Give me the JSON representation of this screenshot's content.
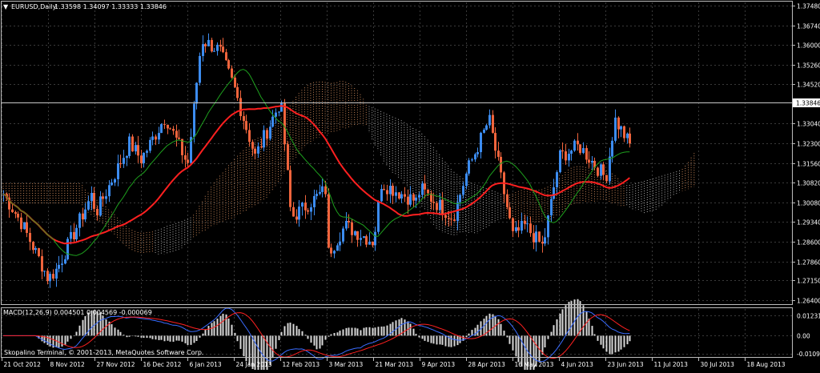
{
  "chart_header": {
    "symbol_text": "EURUSD,Daily",
    "ohlc_text": "1.33598 1.34097 1.33333 1.33846"
  },
  "macd_header": {
    "text": "MACD(12,26,9) 0.004501 0.004569 -0.000069"
  },
  "copyright": "Skopalino Terminal, © 2001-2013, MetaQuotes Software Corp.",
  "colors": {
    "background": "#000000",
    "grid": "#3a3a3a",
    "axis_text": "#ffffff",
    "bull": "#3c8cf0",
    "bear": "#f0643c",
    "ma_slow": "#ff2020",
    "ma_fast": "#1ea01e",
    "cloud_up": "#f4a46c",
    "cloud_down": "#dcdcdc",
    "macd_hist": "#d8d8d8",
    "macd_line": "#3a6cff",
    "signal_line": "#ff2020",
    "current_price_bg": "#ffffff",
    "current_price_fg": "#000000"
  },
  "chart_data": [
    {
      "type": "candlestick",
      "title": "EURUSD,Daily",
      "x_labels": [
        "21 Oct 2012",
        "8 Nov 2012",
        "27 Nov 2012",
        "16 Dec 2012",
        "6 Jan 2013",
        "24 Jan 2013",
        "12 Feb 2013",
        "3 Mar 2013",
        "21 Mar 2013",
        "9 Apr 2013",
        "28 Apr 2013",
        "16 May 2013",
        "4 Jun 2013",
        "23 Jun 2013",
        "11 Jul 2013",
        "30 Jul 2013",
        "18 Aug 2013"
      ],
      "y_ticks": [
        "1.37480",
        "1.36740",
        "1.36000",
        "1.35260",
        "1.34520",
        "1.33846",
        "1.33040",
        "1.32300",
        "1.31560",
        "1.30820",
        "1.30080",
        "1.29340",
        "1.28600",
        "1.27860",
        "1.27150",
        "1.26400"
      ],
      "ylim": [
        1.264,
        1.3748
      ],
      "current_price": "1.33846",
      "close_points": [
        [
          "21 Oct 2012",
          1.305
        ],
        [
          "29 Oct 2012",
          1.293
        ],
        [
          "8 Nov 2012",
          1.272
        ],
        [
          "15 Nov 2012",
          1.276
        ],
        [
          "27 Nov 2012",
          1.296
        ],
        [
          "6 Dec 2012",
          1.305
        ],
        [
          "16 Dec 2012",
          1.317
        ],
        [
          "24 Dec 2012",
          1.323
        ],
        [
          "6 Jan 2013",
          1.315
        ],
        [
          "15 Jan 2013",
          1.333
        ],
        [
          "24 Jan 2013",
          1.344
        ],
        [
          "30 Jan 2013",
          1.362
        ],
        [
          "4 Feb 2013",
          1.358
        ],
        [
          "12 Feb 2013",
          1.339
        ],
        [
          "22 Feb 2013",
          1.318
        ],
        [
          "3 Mar 2013",
          1.306
        ],
        [
          "12 Mar 2013",
          1.295
        ],
        [
          "21 Mar 2013",
          1.286
        ],
        [
          "27 Mar 2013",
          1.281
        ],
        [
          "4 Apr 2013",
          1.292
        ],
        [
          "9 Apr 2013",
          1.306
        ],
        [
          "18 Apr 2013",
          1.308
        ],
        [
          "28 Apr 2013",
          1.312
        ],
        [
          "7 May 2013",
          1.301
        ],
        [
          "16 May 2013",
          1.288
        ],
        [
          "24 May 2013",
          1.295
        ],
        [
          "4 Jun 2013",
          1.318
        ],
        [
          "14 Jun 2013",
          1.332
        ],
        [
          "23 Jun 2013",
          1.31
        ],
        [
          "1 Jul 2013",
          1.292
        ],
        [
          "5 Jul 2013",
          1.284
        ],
        [
          "11 Jul 2013",
          1.308
        ],
        [
          "20 Jul 2013",
          1.322
        ],
        [
          "30 Jul 2013",
          1.328
        ],
        [
          "8 Aug 2013",
          1.332
        ],
        [
          "18 Aug 2013",
          1.3385
        ]
      ],
      "series": [
        {
          "name": "",
          "kind": "moving-average",
          "color": "#ff2020"
        },
        {
          "name": "",
          "kind": "moving-average",
          "color": "#1ea01e"
        },
        {
          "name": "",
          "kind": "ichimoku-cloud"
        }
      ],
      "grid": true
    },
    {
      "type": "histogram",
      "title": "MACD(12,26,9) 0.004501 0.004569 -0.000069",
      "y_ticks": [
        "0.012318",
        "0.00",
        "-0.010975"
      ],
      "ylim": [
        -0.010975,
        0.012318
      ],
      "grid": true
    }
  ]
}
